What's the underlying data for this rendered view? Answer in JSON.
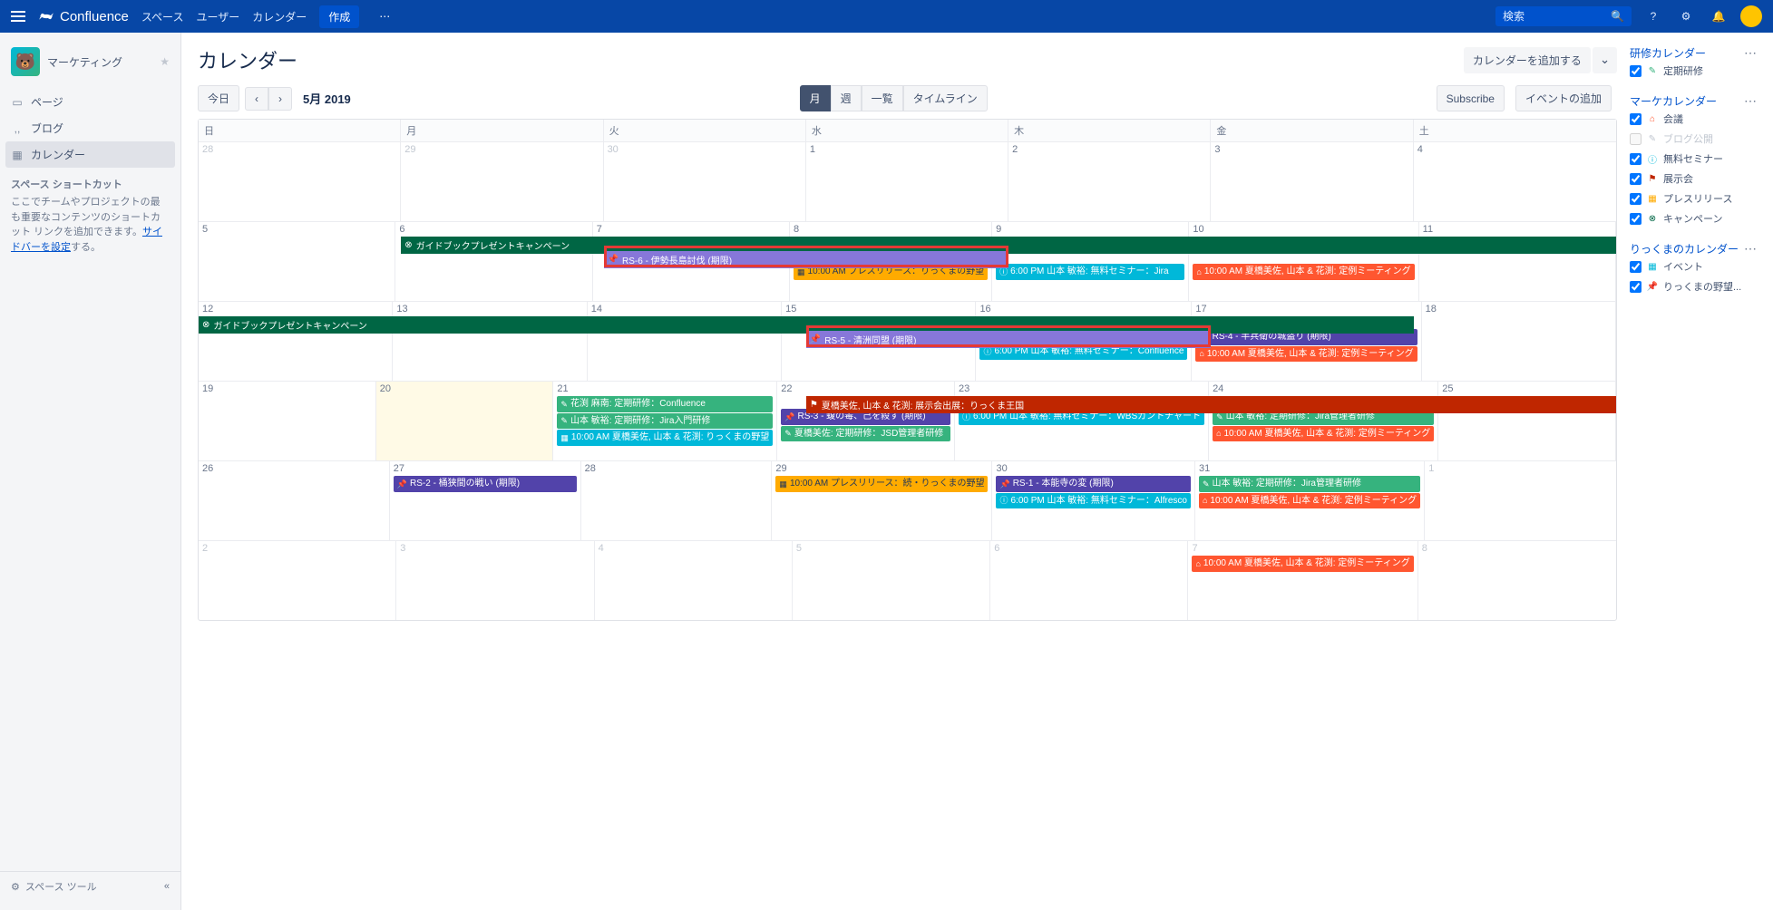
{
  "brand": "Confluence",
  "nav": {
    "spaces": "スペース",
    "users": "ユーザー",
    "calendar": "カレンダー",
    "create": "作成"
  },
  "search": {
    "placeholder": "検索"
  },
  "space": {
    "name": "マーケティング"
  },
  "sideNav": {
    "pages": "ページ",
    "blog": "ブログ",
    "calendar": "カレンダー"
  },
  "shortcuts": {
    "title": "スペース ショートカット",
    "desc1": "ここでチームやプロジェクトの最も重要なコンテンツのショートカット リンクを追加できます。",
    "link": "サイドバーを設定",
    "desc2": "する。"
  },
  "sidebarFooter": "スペース ツール",
  "page": {
    "title": "カレンダー",
    "addCalendar": "カレンダーを追加する"
  },
  "toolbar": {
    "today": "今日",
    "prev": "‹",
    "next": "›",
    "monthLabel": "5月 2019",
    "month": "月",
    "week": "週",
    "list": "一覧",
    "timeline": "タイムライン",
    "subscribe": "Subscribe",
    "addEvent": "イベントの追加"
  },
  "dow": [
    "日",
    "月",
    "火",
    "水",
    "木",
    "金",
    "土"
  ],
  "weeks": [
    {
      "days": [
        {
          "n": "28",
          "o": true
        },
        {
          "n": "29",
          "o": true
        },
        {
          "n": "30",
          "o": true
        },
        {
          "n": "1"
        },
        {
          "n": "2"
        },
        {
          "n": "3"
        },
        {
          "n": "4"
        }
      ]
    },
    {
      "days": [
        {
          "n": "5"
        },
        {
          "n": "6"
        },
        {
          "n": "7"
        },
        {
          "n": "8"
        },
        {
          "n": "9"
        },
        {
          "n": "10"
        },
        {
          "n": "11"
        }
      ]
    },
    {
      "days": [
        {
          "n": "12"
        },
        {
          "n": "13"
        },
        {
          "n": "14"
        },
        {
          "n": "15"
        },
        {
          "n": "16"
        },
        {
          "n": "17"
        },
        {
          "n": "18"
        }
      ]
    },
    {
      "days": [
        {
          "n": "19"
        },
        {
          "n": "20",
          "today": true
        },
        {
          "n": "21"
        },
        {
          "n": "22"
        },
        {
          "n": "23"
        },
        {
          "n": "24"
        },
        {
          "n": "25"
        }
      ]
    },
    {
      "days": [
        {
          "n": "26"
        },
        {
          "n": "27"
        },
        {
          "n": "28"
        },
        {
          "n": "29"
        },
        {
          "n": "30"
        },
        {
          "n": "31"
        },
        {
          "n": "1",
          "o": true
        }
      ]
    },
    {
      "days": [
        {
          "n": "2",
          "o": true
        },
        {
          "n": "3",
          "o": true
        },
        {
          "n": "4",
          "o": true
        },
        {
          "n": "5",
          "o": true
        },
        {
          "n": "6",
          "o": true
        },
        {
          "n": "7",
          "o": true
        },
        {
          "n": "8",
          "o": true
        }
      ]
    }
  ],
  "spanEvents": {
    "campaign1": "ガイドブックプレゼントキャンペーン",
    "campaign2": "ガイドブックプレゼントキャンペーン",
    "rs6": "RS-6 - 伊勢長島討伐 (期限)",
    "rs5": "RS-5 - 清洲同盟 (期限)",
    "exhibit": "夏橋美佐, 山本 & 花渕: 展示会出展：りっくま王国"
  },
  "ev": {
    "w1_8_1": "10:00 AM プレスリリース：りっくまの野望",
    "w1_9_1": "6:00 PM 山本 敏裕: 無料セミナー：Jira",
    "w1_10_1": "10:00 AM 夏橋美佐, 山本 & 花渕: 定例ミーティング",
    "w2_16_1": "6:00 PM 山本 敏裕: 無料セミナー：Confluence",
    "w2_17_1": "RS-4 - 半兵衛の城盗り (期限)",
    "w2_17_2": "10:00 AM 夏橋美佐, 山本 & 花渕: 定例ミーティング",
    "w3_21_1": "花渕 麻南: 定期研修：Confluence",
    "w3_21_2": "山本 敏裕: 定期研修：Jira入門研修",
    "w3_21_3": "10:00 AM 夏橋美佐, 山本 & 花渕: りっくまの野望",
    "w3_22_1": "RS-3 - 蝮の毒、己を殺す (期限)",
    "w3_22_2": "夏橋美佐: 定期研修：JSD管理者研修",
    "w3_23_1": "6:00 PM 山本 敏裕: 無料セミナー：WBSガントチャート",
    "w3_24_1": "山本 敏裕: 定期研修：Jira管理者研修",
    "w3_24_2": "10:00 AM 夏橋美佐, 山本 & 花渕: 定例ミーティング",
    "w4_27_1": "RS-2 - 桶狭間の戦い (期限)",
    "w4_29_1": "10:00 AM プレスリリース：続・りっくまの野望",
    "w4_30_1": "RS-1 - 本能寺の変 (期限)",
    "w4_30_2": "6:00 PM 山本 敏裕: 無料セミナー：Alfresco",
    "w4_31_1": "山本 敏裕: 定期研修：Jira管理者研修",
    "w4_31_2": "10:00 AM 夏橋美佐, 山本 & 花渕: 定例ミーティング",
    "w5_7_1": "10:00 AM 夏橋美佐, 山本 & 花渕: 定例ミーティング"
  },
  "rightPanel": {
    "g1": {
      "title": "研修カレンダー",
      "i1": "定期研修"
    },
    "g2": {
      "title": "マーケカレンダー",
      "i1": "会議",
      "i2": "ブログ公開",
      "i3": "無料セミナー",
      "i4": "展示会",
      "i5": "プレスリリース",
      "i6": "キャンペーン"
    },
    "g3": {
      "title": "りっくまのカレンダー",
      "i1": "イベント",
      "i2": "りっくまの野望..."
    }
  },
  "colors": {
    "green": "#006644",
    "purple": "#8777d9",
    "yellow": "#ffab00",
    "cyan": "#00b8d9",
    "orange": "#ff5630",
    "teal": "#36b37e",
    "darkpurple": "#5243aa",
    "red": "#bf2600"
  }
}
